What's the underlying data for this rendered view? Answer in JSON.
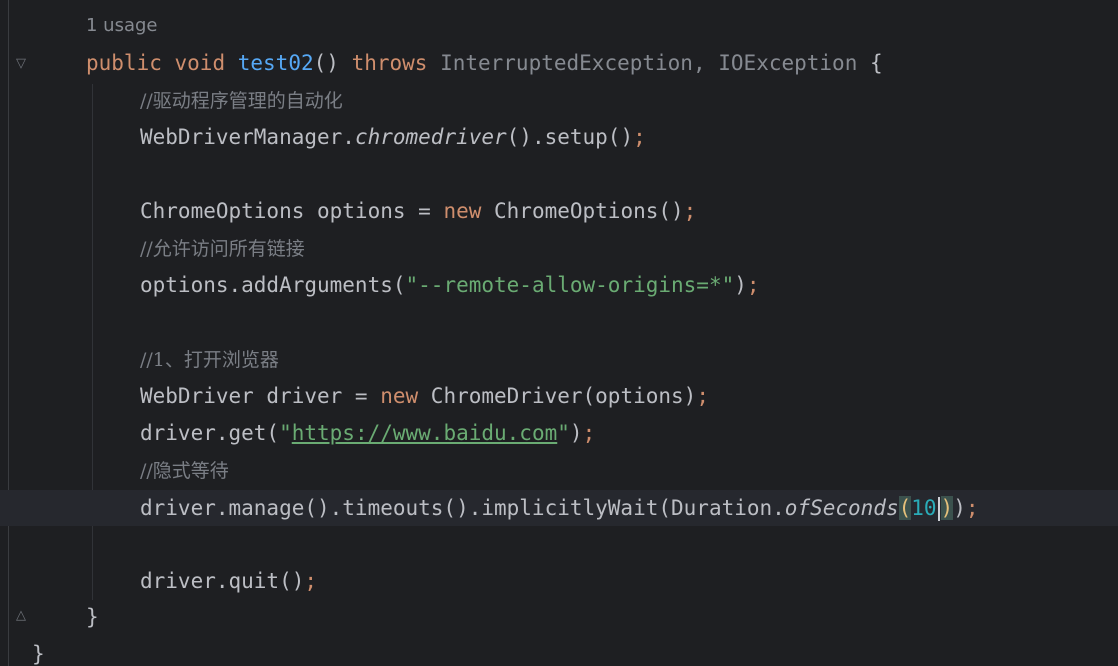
{
  "editor": {
    "usage_hint": "1 usage",
    "lines": {
      "l1": {
        "kw_public": "public",
        "kw_void": "void",
        "method": "test02",
        "parens": "()",
        "kw_throws": "throws",
        "exc1": "InterruptedException",
        "comma": ",",
        "exc2": "IOException",
        "brace": "{"
      },
      "l2": {
        "comment": "//驱动程序管理的自动化"
      },
      "l3": {
        "cls": "WebDriverManager.",
        "method": "chromedriver",
        "rest": "().setup()",
        "semi": ";"
      },
      "l4": {
        "type": "ChromeOptions options = ",
        "kw_new": "new",
        "ctor": " ChromeOptions()",
        "semi": ";"
      },
      "l5": {
        "comment": "//允许访问所有链接"
      },
      "l6": {
        "pre": "options.addArguments(",
        "str": "\"--remote-allow-origins=*\"",
        "post": ")",
        "semi": ";"
      },
      "l7": {
        "comment": "//1、打开浏览器"
      },
      "l8": {
        "pre": "WebDriver driver = ",
        "kw_new": "new",
        "post": " ChromeDriver(options)",
        "semi": ";"
      },
      "l9": {
        "pre": "driver.get(",
        "quote_open": "\"",
        "url": "https://www.baidu.com",
        "quote_close": "\"",
        "post": ")",
        "semi": ";"
      },
      "l10": {
        "comment": "//隐式等待"
      },
      "l11": {
        "pre": "driver.manage().timeouts().implicitlyWait(Duration.",
        "method": "ofSeconds",
        "paren_open": "(",
        "num": "10",
        "paren_close": ")",
        "post": ")",
        "semi": ";"
      },
      "l12": {
        "pre": "driver.quit()",
        "semi": ";"
      },
      "l13": {
        "brace": "}"
      },
      "l14": {
        "brace": "}"
      }
    }
  }
}
